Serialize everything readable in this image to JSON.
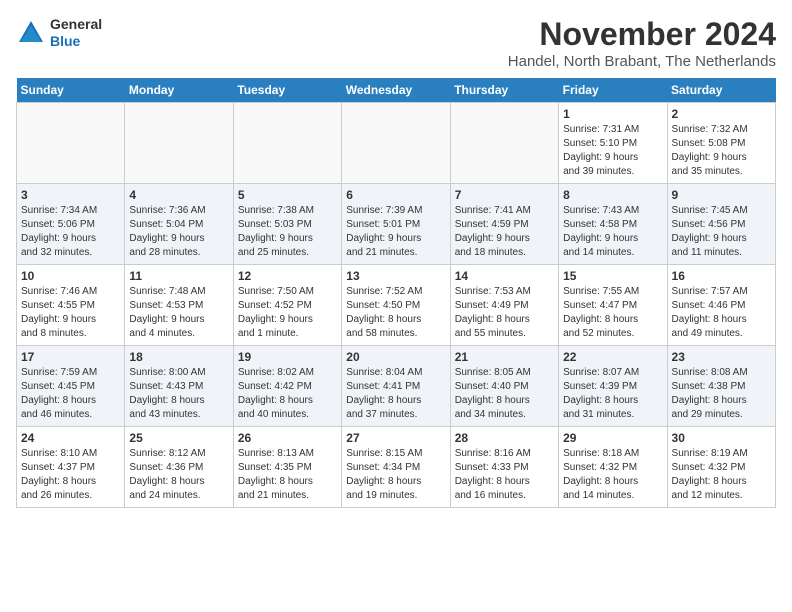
{
  "header": {
    "logo_general": "General",
    "logo_blue": "Blue",
    "month_title": "November 2024",
    "location": "Handel, North Brabant, The Netherlands"
  },
  "calendar": {
    "weekdays": [
      "Sunday",
      "Monday",
      "Tuesday",
      "Wednesday",
      "Thursday",
      "Friday",
      "Saturday"
    ],
    "weeks": [
      [
        {
          "day": "",
          "info": ""
        },
        {
          "day": "",
          "info": ""
        },
        {
          "day": "",
          "info": ""
        },
        {
          "day": "",
          "info": ""
        },
        {
          "day": "",
          "info": ""
        },
        {
          "day": "1",
          "info": "Sunrise: 7:31 AM\nSunset: 5:10 PM\nDaylight: 9 hours\nand 39 minutes."
        },
        {
          "day": "2",
          "info": "Sunrise: 7:32 AM\nSunset: 5:08 PM\nDaylight: 9 hours\nand 35 minutes."
        }
      ],
      [
        {
          "day": "3",
          "info": "Sunrise: 7:34 AM\nSunset: 5:06 PM\nDaylight: 9 hours\nand 32 minutes."
        },
        {
          "day": "4",
          "info": "Sunrise: 7:36 AM\nSunset: 5:04 PM\nDaylight: 9 hours\nand 28 minutes."
        },
        {
          "day": "5",
          "info": "Sunrise: 7:38 AM\nSunset: 5:03 PM\nDaylight: 9 hours\nand 25 minutes."
        },
        {
          "day": "6",
          "info": "Sunrise: 7:39 AM\nSunset: 5:01 PM\nDaylight: 9 hours\nand 21 minutes."
        },
        {
          "day": "7",
          "info": "Sunrise: 7:41 AM\nSunset: 4:59 PM\nDaylight: 9 hours\nand 18 minutes."
        },
        {
          "day": "8",
          "info": "Sunrise: 7:43 AM\nSunset: 4:58 PM\nDaylight: 9 hours\nand 14 minutes."
        },
        {
          "day": "9",
          "info": "Sunrise: 7:45 AM\nSunset: 4:56 PM\nDaylight: 9 hours\nand 11 minutes."
        }
      ],
      [
        {
          "day": "10",
          "info": "Sunrise: 7:46 AM\nSunset: 4:55 PM\nDaylight: 9 hours\nand 8 minutes."
        },
        {
          "day": "11",
          "info": "Sunrise: 7:48 AM\nSunset: 4:53 PM\nDaylight: 9 hours\nand 4 minutes."
        },
        {
          "day": "12",
          "info": "Sunrise: 7:50 AM\nSunset: 4:52 PM\nDaylight: 9 hours\nand 1 minute."
        },
        {
          "day": "13",
          "info": "Sunrise: 7:52 AM\nSunset: 4:50 PM\nDaylight: 8 hours\nand 58 minutes."
        },
        {
          "day": "14",
          "info": "Sunrise: 7:53 AM\nSunset: 4:49 PM\nDaylight: 8 hours\nand 55 minutes."
        },
        {
          "day": "15",
          "info": "Sunrise: 7:55 AM\nSunset: 4:47 PM\nDaylight: 8 hours\nand 52 minutes."
        },
        {
          "day": "16",
          "info": "Sunrise: 7:57 AM\nSunset: 4:46 PM\nDaylight: 8 hours\nand 49 minutes."
        }
      ],
      [
        {
          "day": "17",
          "info": "Sunrise: 7:59 AM\nSunset: 4:45 PM\nDaylight: 8 hours\nand 46 minutes."
        },
        {
          "day": "18",
          "info": "Sunrise: 8:00 AM\nSunset: 4:43 PM\nDaylight: 8 hours\nand 43 minutes."
        },
        {
          "day": "19",
          "info": "Sunrise: 8:02 AM\nSunset: 4:42 PM\nDaylight: 8 hours\nand 40 minutes."
        },
        {
          "day": "20",
          "info": "Sunrise: 8:04 AM\nSunset: 4:41 PM\nDaylight: 8 hours\nand 37 minutes."
        },
        {
          "day": "21",
          "info": "Sunrise: 8:05 AM\nSunset: 4:40 PM\nDaylight: 8 hours\nand 34 minutes."
        },
        {
          "day": "22",
          "info": "Sunrise: 8:07 AM\nSunset: 4:39 PM\nDaylight: 8 hours\nand 31 minutes."
        },
        {
          "day": "23",
          "info": "Sunrise: 8:08 AM\nSunset: 4:38 PM\nDaylight: 8 hours\nand 29 minutes."
        }
      ],
      [
        {
          "day": "24",
          "info": "Sunrise: 8:10 AM\nSunset: 4:37 PM\nDaylight: 8 hours\nand 26 minutes."
        },
        {
          "day": "25",
          "info": "Sunrise: 8:12 AM\nSunset: 4:36 PM\nDaylight: 8 hours\nand 24 minutes."
        },
        {
          "day": "26",
          "info": "Sunrise: 8:13 AM\nSunset: 4:35 PM\nDaylight: 8 hours\nand 21 minutes."
        },
        {
          "day": "27",
          "info": "Sunrise: 8:15 AM\nSunset: 4:34 PM\nDaylight: 8 hours\nand 19 minutes."
        },
        {
          "day": "28",
          "info": "Sunrise: 8:16 AM\nSunset: 4:33 PM\nDaylight: 8 hours\nand 16 minutes."
        },
        {
          "day": "29",
          "info": "Sunrise: 8:18 AM\nSunset: 4:32 PM\nDaylight: 8 hours\nand 14 minutes."
        },
        {
          "day": "30",
          "info": "Sunrise: 8:19 AM\nSunset: 4:32 PM\nDaylight: 8 hours\nand 12 minutes."
        }
      ]
    ]
  }
}
